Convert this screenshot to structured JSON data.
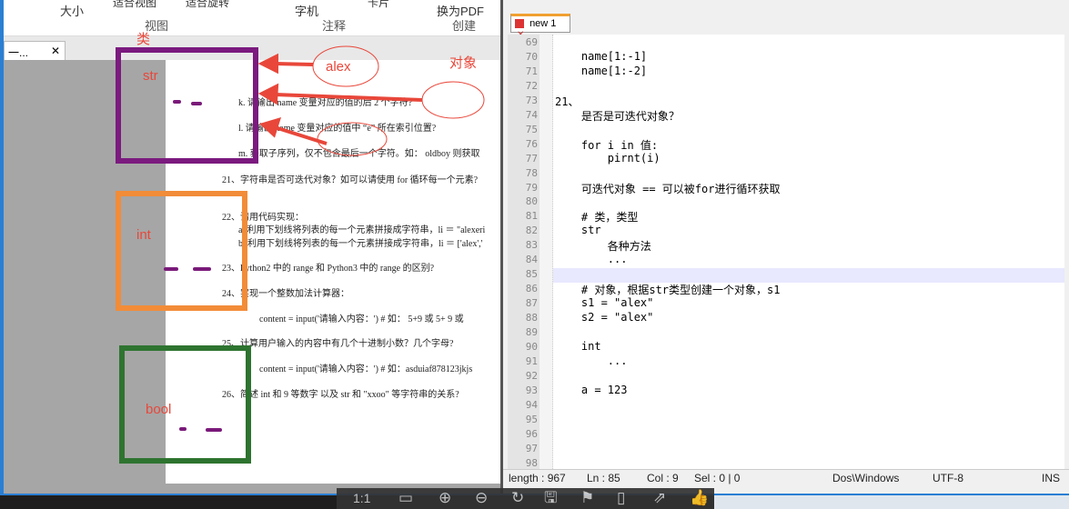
{
  "pdf_viewer": {
    "ribbon": {
      "items": [
        "大小",
        "适合视图",
        "适合旋转",
        "字机",
        "卡片",
        "换为PDF"
      ],
      "groups": [
        "视图",
        "注释",
        "创建"
      ]
    },
    "doc_tab": {
      "label": "一...",
      "close": "✕"
    },
    "questions": [
      "k. 请输出 name 变量对应的值的后 2 个字符?",
      "l. 请输出 name 变量对应的值中 “e” 所在索引位置?",
      "m. 获取子序列，仅不包含最后一个字符。如： oldboy 则获取",
      "21、字符串是否可迭代对象？如可以请使用 for 循环每一个元素?",
      "22、请用代码实现：",
      "a. 利用下划线将列表的每一个元素拼接成字符串，li ＝ \"alexeri",
      "b. 利用下划线将列表的每一个元素拼接成字符串，li ＝ ['alex','",
      "23、Python2 中的 range 和 Python3 中的 range 的区别?",
      "24、实现一个整数加法计算器：",
      "content = input('请输入内容：')    # 如： 5+9 或 5+ 9 或",
      "25、计算用户输入的内容中有几个十进制小数？几个字母?",
      "content = input('请输入内容：')    # 如：asduiaf878123jkjs",
      "26、简述 int 和 9 等数字  以及  str 和 \"xxoo\" 等字符串的关系?"
    ],
    "annotations": {
      "class": "类",
      "object": "对象",
      "alex": "alex",
      "str": "str",
      "int": "int",
      "bool": "bool"
    },
    "colors": {
      "purple": "#7b1a7f",
      "orange": "#f28c38",
      "green": "#2e7430",
      "red": "#e8473a"
    }
  },
  "notepad": {
    "tab": {
      "label": "new 1",
      "close": "✕"
    },
    "lines": [
      {
        "n": "69",
        "t": ""
      },
      {
        "n": "70",
        "t": "    name[1:-1]"
      },
      {
        "n": "71",
        "t": "    name[1:-2]"
      },
      {
        "n": "72",
        "t": ""
      },
      {
        "n": "73",
        "t": "21、"
      },
      {
        "n": "74",
        "t": "    是否是可迭代对象？"
      },
      {
        "n": "75",
        "t": ""
      },
      {
        "n": "76",
        "t": "    for i in 值:"
      },
      {
        "n": "77",
        "t": "        pirnt(i)"
      },
      {
        "n": "78",
        "t": ""
      },
      {
        "n": "79",
        "t": "    可迭代对象 == 可以被for进行循环获取"
      },
      {
        "n": "80",
        "t": ""
      },
      {
        "n": "81",
        "t": "    # 类，类型"
      },
      {
        "n": "82",
        "t": "    str"
      },
      {
        "n": "83",
        "t": "        各种方法"
      },
      {
        "n": "84",
        "t": "        ..."
      },
      {
        "n": "85",
        "t": ""
      },
      {
        "n": "86",
        "t": "    # 对象，根据str类型创建一个对象，s1"
      },
      {
        "n": "87",
        "t": "    s1 = \"alex\""
      },
      {
        "n": "88",
        "t": "    s2 = \"alex\""
      },
      {
        "n": "89",
        "t": ""
      },
      {
        "n": "90",
        "t": "    int"
      },
      {
        "n": "91",
        "t": "        ..."
      },
      {
        "n": "92",
        "t": ""
      },
      {
        "n": "93",
        "t": "    a = 123"
      },
      {
        "n": "94",
        "t": ""
      },
      {
        "n": "95",
        "t": ""
      },
      {
        "n": "96",
        "t": ""
      },
      {
        "n": "97",
        "t": ""
      },
      {
        "n": "98",
        "t": ""
      }
    ],
    "current_line": "85",
    "status": {
      "length": "length : 967",
      "ln": "Ln : 85",
      "col": "Col : 9",
      "sel": "Sel : 0 | 0",
      "eol": "Dos\\Windows",
      "encoding": "UTF-8",
      "mode": "INS"
    }
  },
  "bottom_toolbar": {
    "page": "1:1"
  }
}
